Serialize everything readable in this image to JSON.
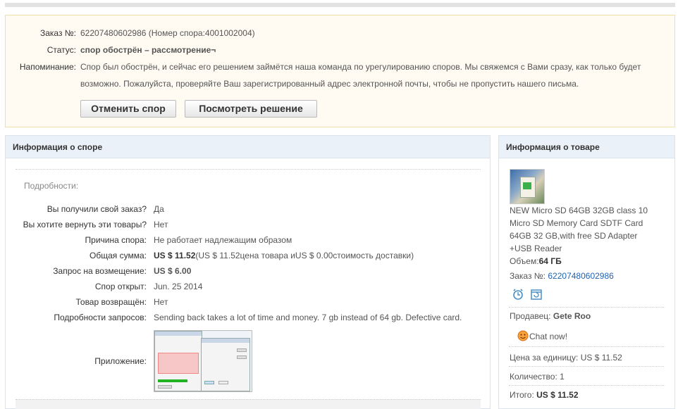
{
  "dispute_header": {
    "order_label": "Заказ №:",
    "order_value": "62207480602986 (Номер спора:4001002004)",
    "status_label": "Статус:",
    "status_value": "спор обострён – рассмотрение¬",
    "reminder_label": "Напоминание:",
    "reminder_line1": "Спор был обострён, и сейчас его решением займётся наша команда по урегулированию споров. Мы свяжемся с Вами сразу, как только будет",
    "reminder_line2": "возможно. Пожалуйста, проверяйте Ваш зарегистрированный адрес электронной почты, чтобы не пропустить нашего письма.",
    "cancel_button": "Отменить спор",
    "view_button": "Посмотреть решение"
  },
  "dispute_info": {
    "title": "Информация о споре",
    "details_heading": "Подробности:",
    "rows": [
      {
        "label": "Вы получили свой заказ?",
        "value": "Да"
      },
      {
        "label": "Вы хотите вернуть эти товары?",
        "value": "Нет"
      },
      {
        "label": "Причина спора:",
        "value": "Не работает надлежащим образом"
      },
      {
        "label": "Общая сумма:",
        "value_bold": "US $ 11.52",
        "value": "(US $ 11.52цена товара иUS $ 0.00стоимость доставки)"
      },
      {
        "label": "Запрос на возмещение:",
        "value": "US $ 6.00"
      },
      {
        "label": "Спор открыт:",
        "value": "Jun. 25 2014"
      },
      {
        "label": "Товар возвращён:",
        "value": "Нет"
      },
      {
        "label": "Подробности запросов:",
        "value": "Sending back takes a lot of time and money. 7 gb instead of 64 gb. Defective card."
      }
    ],
    "attachment_label": "Приложение:"
  },
  "product_info": {
    "title": "Информация о товаре",
    "product_name_line1": "NEW Micro SD 64GB 32GB class 10",
    "product_name_line2": "Micro SD Memory Card SDTF Card",
    "product_name_line3": "64GB 32 GB,with free SD Adapter",
    "product_name_line4": "+USB Reader",
    "volume_label": "Объем:",
    "volume_value": "64 ГБ",
    "order_label": "Заказ №:",
    "order_value": "62207480602986",
    "seller_label": "Продавец:",
    "seller_value": "Gete Roo",
    "chat_label": "Chat now!",
    "unit_price_label": "Цена за единицу:",
    "unit_price_value": "US $ 11.52",
    "quantity_label": "Количество:",
    "quantity_value": "1",
    "total_label": "Итого:",
    "total_value": "US $ 11.52"
  },
  "colors": {
    "status_green": "#2b9a1f",
    "refund_orange": "#f36e13",
    "link_blue": "#1f63b5",
    "panel_header": "#eaf1f8",
    "alert_bg": "#fffbf2"
  }
}
